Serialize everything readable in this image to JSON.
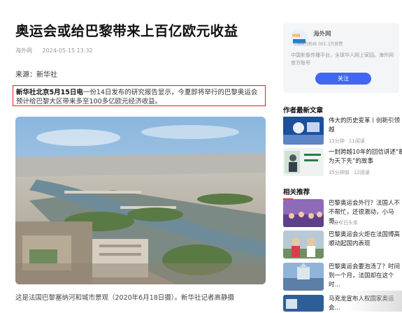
{
  "article": {
    "title": "奥运会或给巴黎带来上百亿欧元收益",
    "publisher": "海外网",
    "timestamp": "2024-05-15 13:32",
    "source": "来源：新华社",
    "lead_bold": "新华社北京5月15日电",
    "lead_text": "一份14日发布的研究报告显示，今夏即将举行的巴黎奥运会预计给巴黎大区带来多至100多亿欧元经济收益。",
    "caption": "这是法国巴黎塞纳河和城市景观（2020年6月18日摄）。新华社记者高静摄"
  },
  "author_card": {
    "name": "海外网",
    "stats": "0566万粉丝 001.3万获赞",
    "description": "中国影像传播平台，全球华人网上家园。海外网官方账号",
    "follow_label": "关注"
  },
  "author_articles": {
    "heading": "作者最新文章",
    "items": [
      {
        "title": "伟大的历史变革丨创新引领越",
        "time": "12分钟",
        "reads": "11阅读"
      },
      {
        "title": "一封跨越10年的回信讲述“敢为天下先”的故事",
        "time": "35分钟前",
        "reads": "12阅读"
      }
    ]
  },
  "recommend": {
    "heading": "相关推荐",
    "items": [
      {
        "title": "巴黎奥运会外行？法国人不不帮忙，还很激动，小马哥...",
        "meta": "人民今日头条"
      },
      {
        "title": "巴黎奥运会火炬在法国博高顺动起国内表现",
        "meta": ""
      },
      {
        "title": "巴黎奥运会要泡汤了？时间到一个月，法国却在这个时...",
        "meta": ""
      },
      {
        "title": "马克龙宣布人权国家奥运会...",
        "meta": ""
      }
    ]
  }
}
